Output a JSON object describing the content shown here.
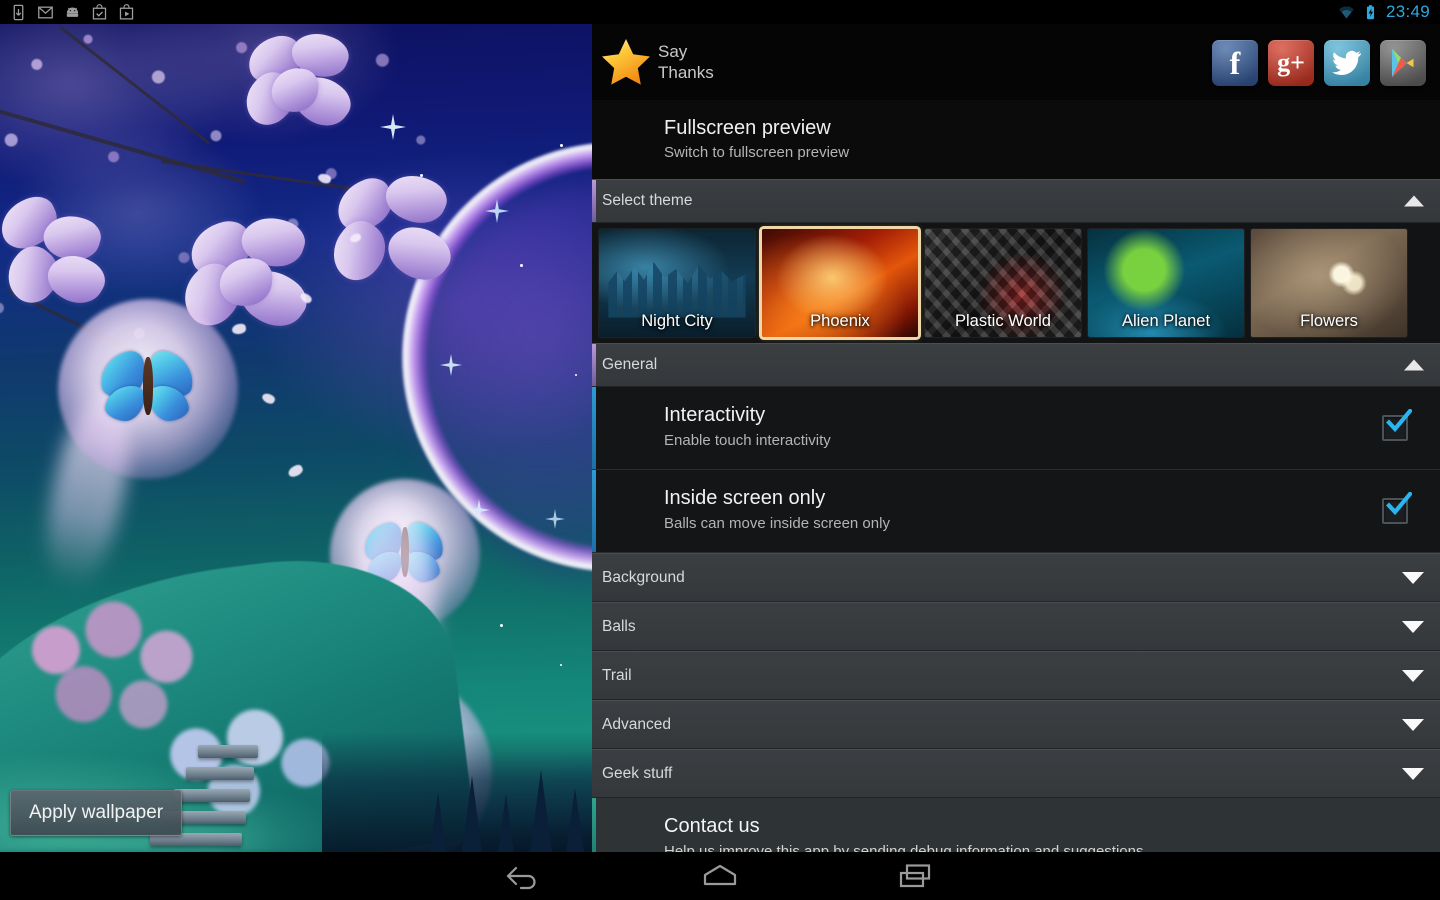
{
  "statusbar": {
    "left_icons": [
      "download-icon",
      "gmail-icon",
      "android-icon",
      "checkbox-app-icon",
      "play-video-icon"
    ],
    "right_icons": [
      "wifi-icon",
      "battery-charging-icon"
    ],
    "clock": "23:49",
    "accent_color": "#2da9e0"
  },
  "preview": {
    "apply_button": "Apply wallpaper",
    "scene": "night-sky-cherry-blossom-butterfly-orbs"
  },
  "panel": {
    "brand": {
      "line1": "Say",
      "line2": "Thanks",
      "icon": "star-icon"
    },
    "socials": [
      {
        "name": "facebook-button",
        "glyph": "f",
        "color": "#3f5e97"
      },
      {
        "name": "google-plus-button",
        "glyph": "g+",
        "color": "#c8372a"
      },
      {
        "name": "twitter-button",
        "glyph": "т",
        "color": "#4fa9cd"
      },
      {
        "name": "google-play-button",
        "glyph": "▶",
        "color": "#6b6b6b"
      }
    ],
    "fullscreen": {
      "title": "Fullscreen preview",
      "subtitle": "Switch to fullscreen preview"
    },
    "select_theme": {
      "label": "Select theme",
      "expanded": true,
      "caret": "caret-up-icon",
      "themes": [
        {
          "name": "Night City",
          "selected": false
        },
        {
          "name": "Phoenix",
          "selected": true
        },
        {
          "name": "Plastic World",
          "selected": false
        },
        {
          "name": "Alien Planet",
          "selected": false
        },
        {
          "name": "Flowers",
          "selected": false
        }
      ]
    },
    "general": {
      "label": "General",
      "expanded": true,
      "caret": "caret-up-icon",
      "prefs": [
        {
          "title": "Interactivity",
          "subtitle": "Enable touch interactivity",
          "checked": true
        },
        {
          "title": "Inside screen only",
          "subtitle": "Balls can move inside screen only",
          "checked": true
        }
      ]
    },
    "collapsed_sections": [
      {
        "label": "Background",
        "caret": "caret-down-icon"
      },
      {
        "label": "Balls",
        "caret": "caret-down-icon"
      },
      {
        "label": "Trail",
        "caret": "caret-down-icon"
      },
      {
        "label": "Advanced",
        "caret": "caret-down-icon"
      },
      {
        "label": "Geek stuff",
        "caret": "caret-down-icon"
      }
    ],
    "contact": {
      "title": "Contact us",
      "subtitle": "Help us improve this app by sending debug information and suggestions"
    }
  },
  "navbar": {
    "buttons": [
      {
        "name": "back-button",
        "icon": "back-arrow-icon"
      },
      {
        "name": "home-button",
        "icon": "home-icon"
      },
      {
        "name": "recents-button",
        "icon": "recents-icon"
      }
    ]
  }
}
